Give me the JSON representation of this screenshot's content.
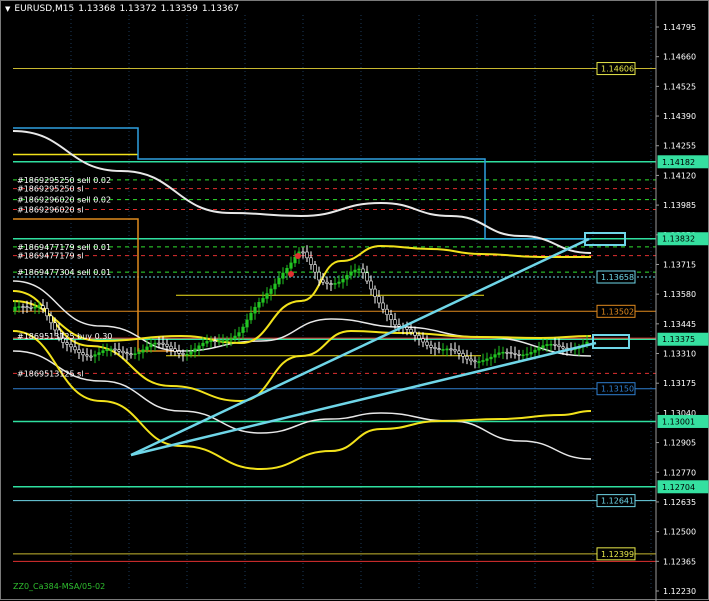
{
  "header": {
    "menu_icon": "triangle-down-icon",
    "symbol": "EURUSD,M15",
    "open": "1.13368",
    "high": "1.13372",
    "low": "1.13359",
    "close": "1.13367"
  },
  "footer": {
    "text": "ZZ0_Ca384-MSA/05-02"
  },
  "colors": {
    "background": "#000000",
    "grid": "#1d3a5a",
    "bull_candle": "#22c522",
    "bear_candle": "#ffffff",
    "ma_yellow": "#f2e21b",
    "ma_white": "#e8e8e8",
    "cyan": "#6fd6e8",
    "green_line": "#2fe0a0",
    "orange": "#e08a1e",
    "red": "#e03030"
  },
  "price_axis": {
    "ticks": [
      "1.14795",
      "1.14660",
      "1.14525",
      "1.14390",
      "1.14255",
      "1.14120",
      "1.13985",
      "1.13850",
      "1.13715",
      "1.13580",
      "1.13445",
      "1.13310",
      "1.13175",
      "1.13040",
      "1.12905",
      "1.12770",
      "1.12635",
      "1.12500",
      "1.12365",
      "1.12230"
    ]
  },
  "price_tags": [
    {
      "label": "1.14606",
      "price": 1.14606,
      "color": "#e8e84a",
      "style": "box"
    },
    {
      "label": "1.14182",
      "price": 1.14182,
      "color": "#35e0a0",
      "style": "fill"
    },
    {
      "label": "1.13832",
      "price": 1.13832,
      "color": "#35e0a0",
      "style": "fill"
    },
    {
      "label": "1.13658",
      "price": 1.13658,
      "color": "#6fd6e8",
      "style": "box"
    },
    {
      "label": "1.13502",
      "price": 1.13502,
      "color": "#e08a1e",
      "style": "box"
    },
    {
      "label": "1.13375",
      "price": 1.13375,
      "color": "#35e0a0",
      "style": "fill"
    },
    {
      "label": "1.13150",
      "price": 1.1315,
      "color": "#2f7fd0",
      "style": "box"
    },
    {
      "label": "1.13001",
      "price": 1.13001,
      "color": "#35e0a0",
      "style": "fill"
    },
    {
      "label": "1.12704",
      "price": 1.12704,
      "color": "#35e0a0",
      "style": "fill"
    },
    {
      "label": "1.12641",
      "price": 1.12641,
      "color": "#6fd6e8",
      "style": "box"
    },
    {
      "label": "1.12399",
      "price": 1.12399,
      "color": "#e8e84a",
      "style": "box"
    }
  ],
  "order_labels": [
    {
      "text": "#1869295250 sell 0.02",
      "price": 1.141
    },
    {
      "text": "#1869295250 sl",
      "price": 1.1406
    },
    {
      "text": "#1869296020 sell 0.02",
      "price": 1.1401
    },
    {
      "text": "#1869296020 sl",
      "price": 1.13965
    },
    {
      "text": "#1869477179 sell 0.01",
      "price": 1.13795
    },
    {
      "text": "#1869477179 sl",
      "price": 1.13755
    },
    {
      "text": "#1869477304 sell 0.01",
      "price": 1.1368
    },
    {
      "text": "#1869513125 buy 0.30",
      "price": 1.1339
    },
    {
      "text": "#1869513125 sl",
      "price": 1.1322
    }
  ]
}
